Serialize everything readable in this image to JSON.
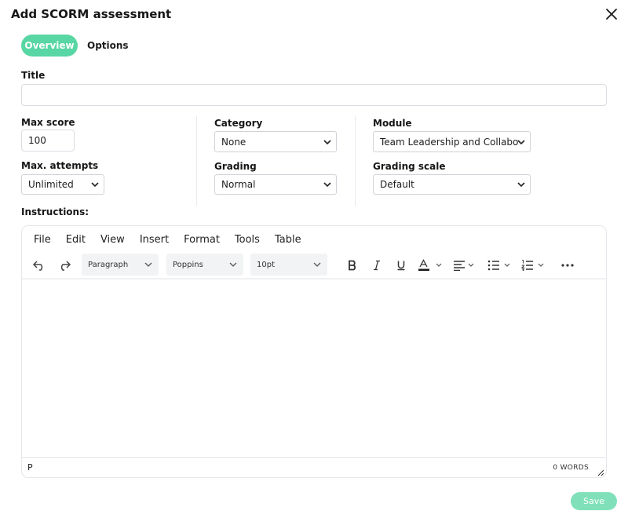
{
  "dialog": {
    "title": "Add SCORM assessment"
  },
  "tabs": [
    {
      "label": "Overview",
      "active": true
    },
    {
      "label": "Options",
      "active": false
    }
  ],
  "form": {
    "title_label": "Title",
    "title_value": "",
    "max_score_label": "Max score",
    "max_score_value": "100",
    "max_attempts_label": "Max. attempts",
    "max_attempts_value": "Unlimited",
    "category_label": "Category",
    "category_value": "None",
    "grading_label": "Grading",
    "grading_value": "Normal",
    "module_label": "Module",
    "module_value": "Team Leadership and Collabo",
    "grading_scale_label": "Grading scale",
    "grading_scale_value": "Default",
    "instructions_label": "Instructions:"
  },
  "editor": {
    "menu": [
      "File",
      "Edit",
      "View",
      "Insert",
      "Format",
      "Tools",
      "Table"
    ],
    "block_format": "Paragraph",
    "font_family": "Poppins",
    "font_size": "10pt",
    "status_path": "P",
    "word_count": "0 WORDS"
  },
  "footer": {
    "save_label": "Save"
  },
  "colors": {
    "accent": "#58d6a3",
    "save_button": "#7fe0b9"
  }
}
